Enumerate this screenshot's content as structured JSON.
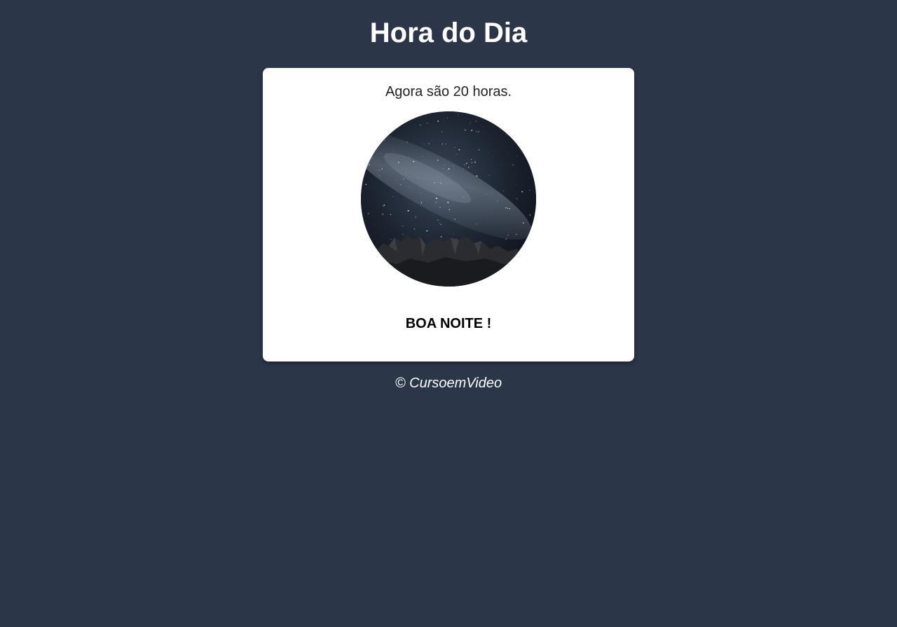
{
  "header": {
    "title": "Hora do Dia"
  },
  "card": {
    "time_message": "Agora são 20 horas.",
    "image": {
      "subject": "night-sky-with-mountains",
      "period": "night"
    },
    "greeting": "BOA NOITE !"
  },
  "footer": {
    "copyright": "© CursoemVideo"
  },
  "colors": {
    "page_background": "#2c3649",
    "card_background": "#ffffff",
    "title_text": "#ffffff",
    "greeting_text": "#000000"
  }
}
